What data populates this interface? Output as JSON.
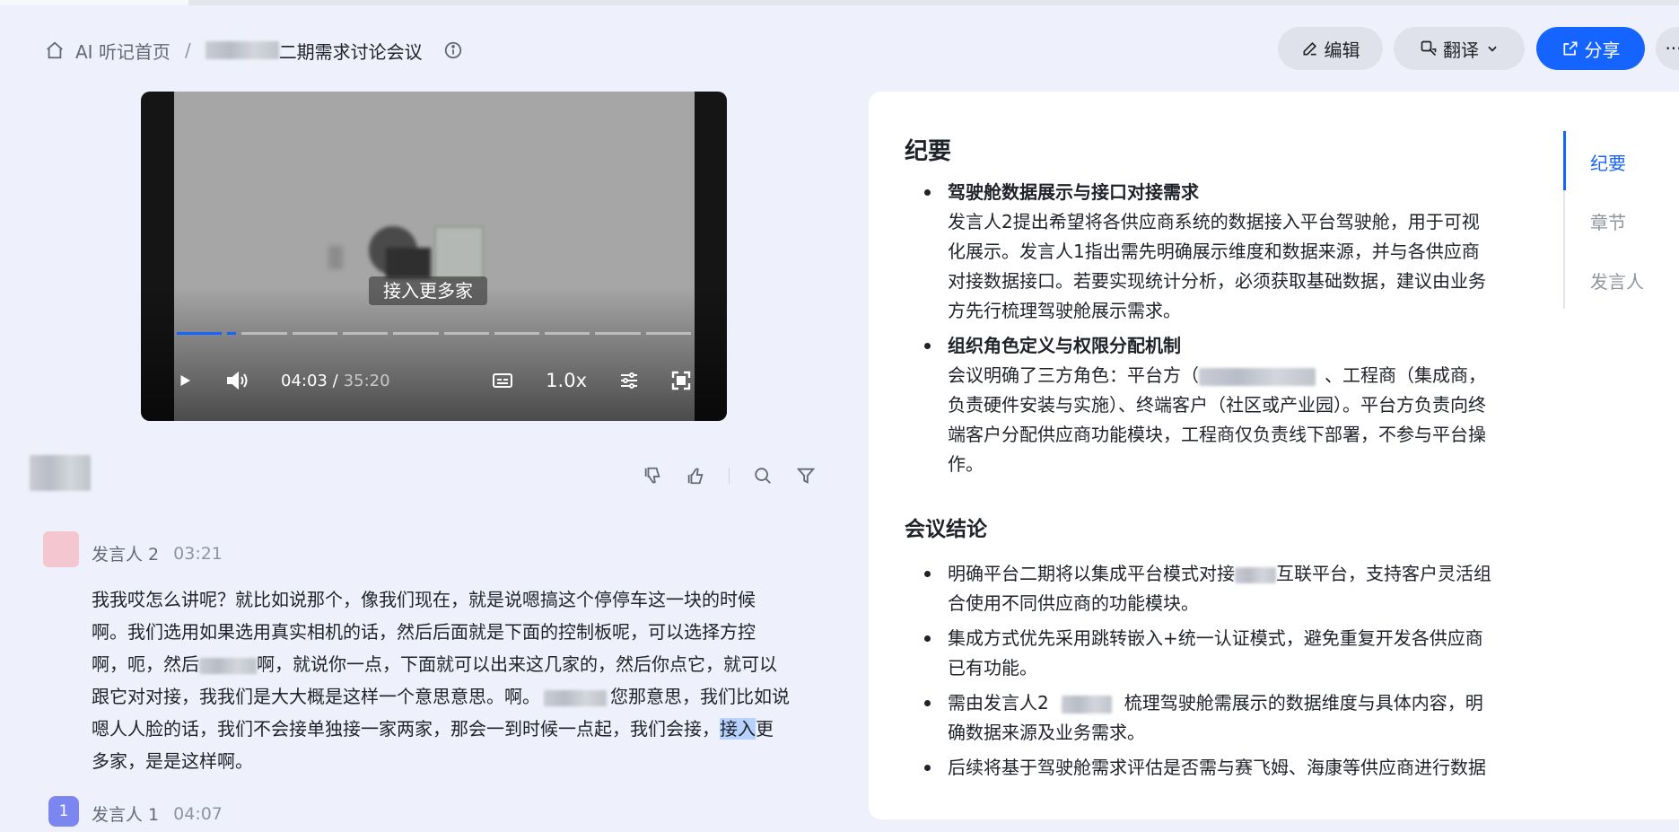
{
  "breadcrumb": {
    "home": "AI 听记首页",
    "separator": "/",
    "title_suffix": "二期需求讨论会议"
  },
  "header": {
    "edit_label": "编辑",
    "translate_label": "翻译",
    "share_label": "分享",
    "more_label": "···"
  },
  "video": {
    "subtitle": "接入更多家",
    "time_current": "04:03 /",
    "time_total": "35:20",
    "speed": "1.0x",
    "progress": 0.115
  },
  "transcript": {
    "utterances": [
      {
        "speaker": "发言人 2",
        "time": "03:21",
        "lines": [
          "我我哎怎么讲呢？就比如说那个，像我们现在，就是说嗯搞这个停停车这一块的时候",
          "啊。我们选用如果选用真实相机的话，然后后面就是下面的控制板呢，可以选择方控",
          "啊，呃，然后",
          "啊，就说你一点，下面就可以出来这几家的，然后你点它，就可以",
          "跟它对对接，我我们是大大概是这样一个意思意思。啊。",
          "您那意思，我们比如说",
          "嗯人人脸的话，我们不会接单独接一家两家，那会一到时候一点起，我们会接，",
          "接入",
          "更",
          "多家，是是这样啊。"
        ]
      },
      {
        "avatar_initial": "1",
        "speaker": "发言人 1",
        "time": "04:07"
      }
    ]
  },
  "summary": {
    "heading": "纪要",
    "items": [
      {
        "title": "驾驶舱数据展示与接口对接需求",
        "body": "发言人2提出希望将各供应商系统的数据接入平台驾驶舱，用于可视化展示。发言人1指出需先明确展示维度和数据来源，并与各供应商对接数据接口。若要实现统计分析，必须获取基础数据，建议由业务方先行梳理驾驶舱展示需求。"
      },
      {
        "title": "组织角色定义与权限分配机制",
        "body_a": "会议明确了三方角色：平台方（",
        "body_b": "、工程商（集成商，负责硬件安装与实施）、终端客户（社区或产业园）。平台方负责向终端客户分配供应商功能模块，工程商仅负责线下部署，不参与平台操作。"
      }
    ]
  },
  "conclusion": {
    "heading": "会议结论",
    "items": [
      {
        "a": "明确平台二期将以集成平台模式对接",
        "b": "互联平台，支持客户灵活组合使用不同供应商的功能模块。"
      },
      {
        "a": "集成方式优先采用跳转嵌入+统一认证模式，避免重复开发各供应商已有功能。",
        "b": ""
      },
      {
        "a": "需由发言人2",
        "b": "梳理驾驶舱需展示的数据维度与具体内容，明确数据来源及业务需求。"
      },
      {
        "a": "后续将基于驾驶舱需求评估是否需与赛飞姆、海康等供应商进行数据",
        "b": ""
      }
    ]
  },
  "toc": {
    "items": [
      "纪要",
      "章节",
      "发言人"
    ],
    "active": 0
  },
  "colors": {
    "accent": "#1664ff",
    "background": "#eef1fb",
    "highlight": "#b7d2ff"
  }
}
